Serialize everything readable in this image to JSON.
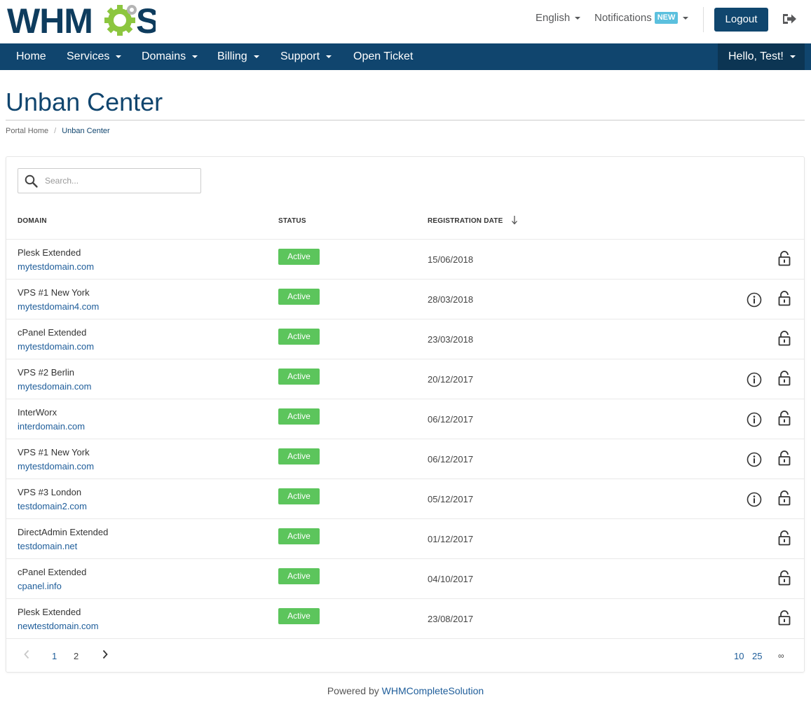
{
  "header": {
    "logo_text": "WHMCS",
    "language": "English",
    "notifications": "Notifications",
    "notifications_badge": "NEW",
    "logout": "Logout"
  },
  "nav": {
    "items": [
      {
        "label": "Home"
      },
      {
        "label": "Services"
      },
      {
        "label": "Domains"
      },
      {
        "label": "Billing"
      },
      {
        "label": "Support"
      },
      {
        "label": "Open Ticket"
      }
    ],
    "user": "Hello, Test!"
  },
  "page": {
    "title": "Unban Center",
    "breadcrumb": [
      "Portal Home",
      "Unban Center"
    ]
  },
  "search": {
    "placeholder": "Search..."
  },
  "table": {
    "headers": [
      "DOMAIN",
      "STATUS",
      "REGISTRATION DATE"
    ],
    "rows": [
      {
        "name": "Plesk Extended",
        "domain": "mytestdomain.com",
        "status": "Active",
        "date": "15/06/2018",
        "info": false
      },
      {
        "name": "VPS #1 New York",
        "domain": "mytestdomain4.com",
        "status": "Active",
        "date": "28/03/2018",
        "info": true
      },
      {
        "name": "cPanel Extended",
        "domain": "mytestdomain.com",
        "status": "Active",
        "date": "23/03/2018",
        "info": false
      },
      {
        "name": "VPS #2 Berlin",
        "domain": "mytesdomain.com",
        "status": "Active",
        "date": "20/12/2017",
        "info": true
      },
      {
        "name": "InterWorx",
        "domain": "interdomain.com",
        "status": "Active",
        "date": "06/12/2017",
        "info": true
      },
      {
        "name": "VPS #1 New York",
        "domain": "mytestdomain.com",
        "status": "Active",
        "date": "06/12/2017",
        "info": true
      },
      {
        "name": "VPS #3 London",
        "domain": "testdomain2.com",
        "status": "Active",
        "date": "05/12/2017",
        "info": true
      },
      {
        "name": "DirectAdmin Extended",
        "domain": "testdomain.net",
        "status": "Active",
        "date": "01/12/2017",
        "info": false
      },
      {
        "name": "cPanel Extended",
        "domain": "cpanel.info",
        "status": "Active",
        "date": "04/10/2017",
        "info": false
      },
      {
        "name": "Plesk Extended",
        "domain": "newtestdomain.com",
        "status": "Active",
        "date": "23/08/2017",
        "info": false
      }
    ]
  },
  "pagination": {
    "pages": [
      "1",
      "2"
    ],
    "current_page": "1",
    "page_sizes": [
      "10",
      "25",
      "∞"
    ],
    "current_size": "10"
  },
  "footer": {
    "powered_prefix": "Powered by ",
    "powered_link": "WHMCompleteSolution"
  },
  "colors": {
    "brand": "#10456e",
    "status_active": "#5cc55c",
    "link": "#1e5d9a",
    "badge": "#5bc0de"
  }
}
